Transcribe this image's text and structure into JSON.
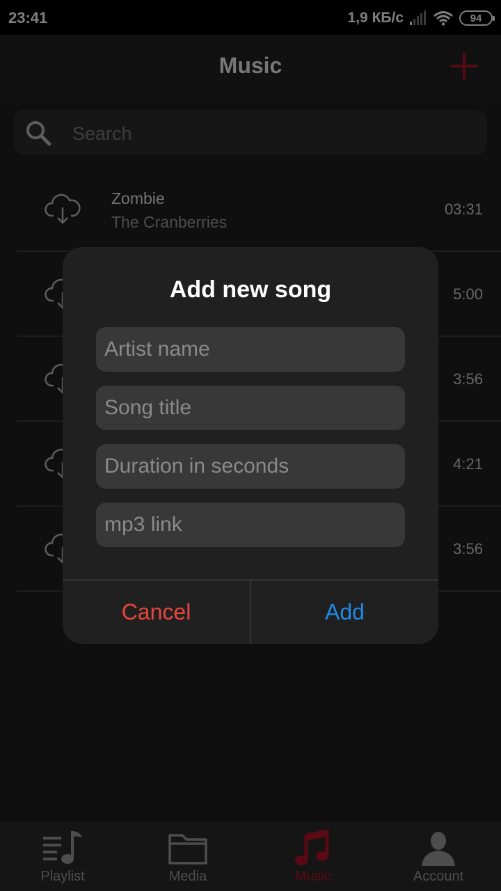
{
  "status_bar": {
    "time": "23:41",
    "speed": "1,9 КБ/с",
    "battery": "94"
  },
  "header": {
    "title": "Music",
    "accent_color": "#b3152a"
  },
  "search": {
    "placeholder": "Search"
  },
  "songs": [
    {
      "title": "Zombie",
      "artist": "The Cranberries",
      "duration": "03:31"
    },
    {
      "title": "",
      "artist": "",
      "duration": "5:00"
    },
    {
      "title": "",
      "artist": "",
      "duration": "3:56"
    },
    {
      "title": "",
      "artist": "",
      "duration": "4:21"
    },
    {
      "title": "",
      "artist": "",
      "duration": "3:56"
    }
  ],
  "tabs": [
    {
      "label": "Playlist",
      "icon": "playlist-icon",
      "active": false
    },
    {
      "label": "Media",
      "icon": "folder-icon",
      "active": false
    },
    {
      "label": "Music",
      "icon": "music-note-icon",
      "active": true
    },
    {
      "label": "Account",
      "icon": "account-icon",
      "active": false
    }
  ],
  "dialog": {
    "title": "Add new song",
    "fields": {
      "artist_placeholder": "Artist name",
      "title_placeholder": "Song title",
      "duration_placeholder": "Duration in seconds",
      "link_placeholder": "mp3 link"
    },
    "cancel_label": "Cancel",
    "add_label": "Add",
    "cancel_color": "#e8453c",
    "add_color": "#1e88e5"
  }
}
